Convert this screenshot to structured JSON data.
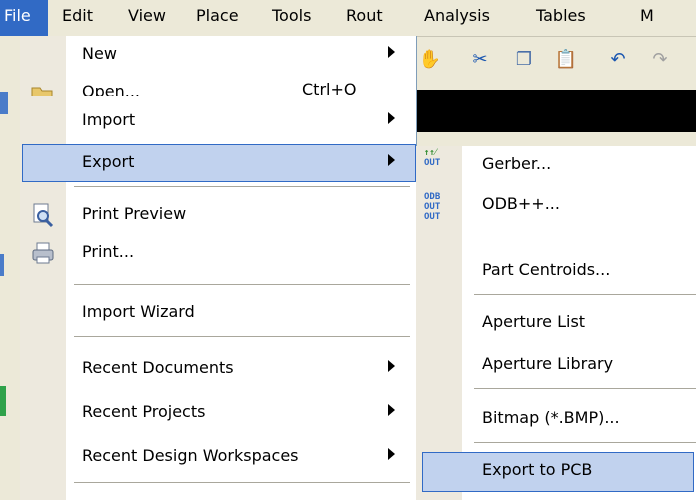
{
  "menubar": {
    "items": [
      "File",
      "Edit",
      "View",
      "Place",
      "Tools",
      "Rout",
      "Analysis",
      "Tables",
      "M"
    ]
  },
  "file_menu": {
    "new": "New",
    "open": "Open...",
    "open_shortcut": "Ctrl+O",
    "import": "Import",
    "export": "Export",
    "print_preview": "Print Preview",
    "print": "Print...",
    "import_wizard": "Import Wizard",
    "recent_documents": "Recent Documents",
    "recent_projects": "Recent Projects",
    "recent_design_workspaces": "Recent Design Workspaces"
  },
  "export_submenu": {
    "gerber": "Gerber...",
    "odb": "ODB++...",
    "part_centroids": "Part Centroids...",
    "aperture_list": "Aperture List",
    "aperture_library": "Aperture Library",
    "bitmap": "Bitmap (*.BMP)...",
    "export_to_pcb": "Export to PCB"
  },
  "icons": {
    "gerber": "gerber-out-icon",
    "odb": "odb-out-icon",
    "print_preview": "print-preview-icon",
    "print": "printer-icon",
    "open": "open-folder-icon"
  }
}
